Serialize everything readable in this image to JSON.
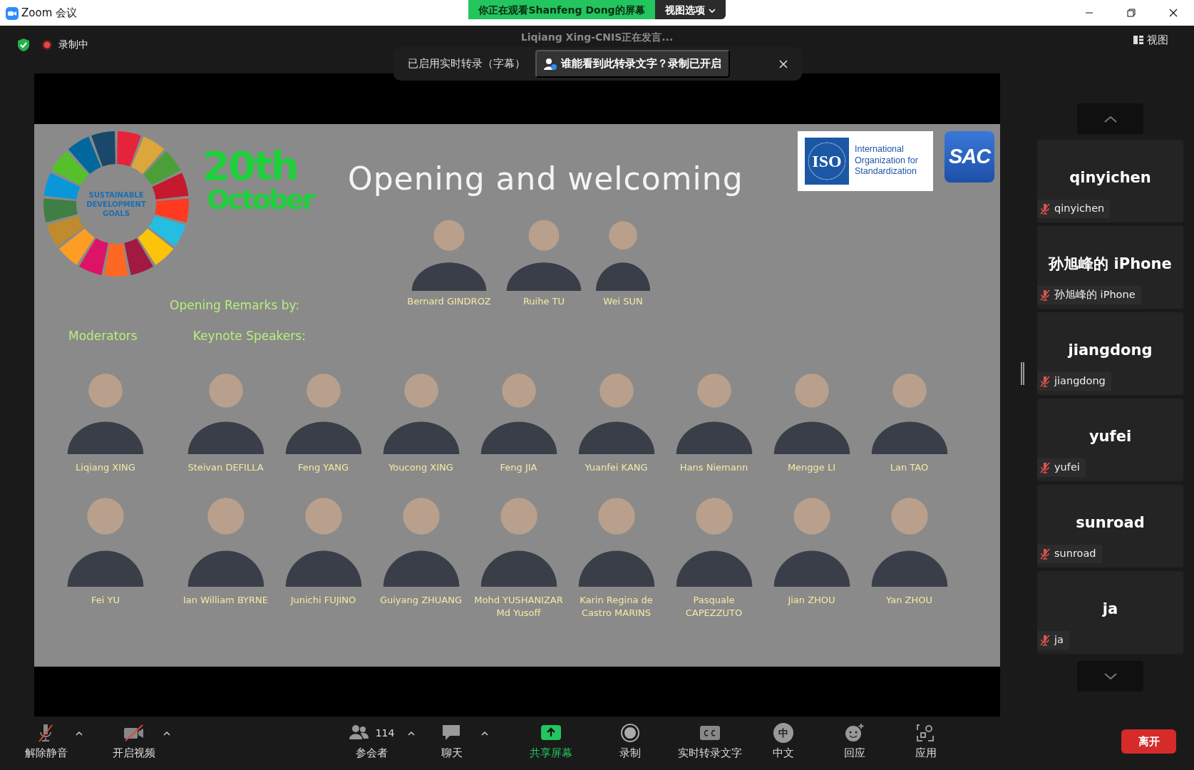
{
  "window": {
    "title": "Zoom 会议"
  },
  "share_banner": {
    "viewing": "你正在观看Shanfeng Dong的屏幕",
    "view_options": "视图选项"
  },
  "meeting_bar": {
    "recording": "录制中",
    "speaker": "Liqiang  Xing-CNIS正在发言...",
    "view": "视图"
  },
  "transcript_notice": {
    "status": "已启用实时转录（字幕）",
    "question": "谁能看到此转录文字？录制已开启"
  },
  "slide": {
    "sdg_logo_text": "SUSTAINABLE DEVELOPMENT GOALS",
    "date": [
      "20th",
      "October"
    ],
    "title": "Opening and welcoming",
    "iso_mark": "ISO",
    "iso_name": "International Organization for Standardization",
    "sac_mark": "SAC",
    "remarks_label": "Opening Remarks by:",
    "remarks_speakers": [
      {
        "name": "Bernard GINDROZ"
      },
      {
        "name": "Ruihe TU"
      },
      {
        "name": "Wei SUN"
      }
    ],
    "moderators_label": "Moderators",
    "keynote_label": "Keynote Speakers:",
    "moderators": [
      {
        "name": "Liqiang XING"
      },
      {
        "name": "Fei YU"
      }
    ],
    "keynote_speakers": [
      {
        "name": "Steivan DEFILLA"
      },
      {
        "name": "Feng YANG"
      },
      {
        "name": "Youcong XING"
      },
      {
        "name": "Feng JIA"
      },
      {
        "name": "Yuanfei KANG"
      },
      {
        "name": "Hans Niemann"
      },
      {
        "name": "Mengge LI"
      },
      {
        "name": "Lan TAO"
      },
      {
        "name": "Ian William BYRNE"
      },
      {
        "name": "Junichi FUJINO"
      },
      {
        "name": "Guiyang ZHUANG"
      },
      {
        "name": "Mohd YUSHANIZAR\nMd Yusoff"
      },
      {
        "name": "Karin Regina de\nCastro MARINS"
      },
      {
        "name": "Pasquale\nCAPEZZUTO"
      },
      {
        "name": "Jian ZHOU"
      },
      {
        "name": "Yan ZHOU"
      }
    ]
  },
  "participants": [
    {
      "display_name": "qinyichen",
      "label": "qinyichen",
      "muted": true
    },
    {
      "display_name": "孙旭峰的 iPhone",
      "label": "孙旭峰的 iPhone",
      "muted": true
    },
    {
      "display_name": "jiangdong",
      "label": "jiangdong",
      "muted": true
    },
    {
      "display_name": "yufei",
      "label": "yufei",
      "muted": true
    },
    {
      "display_name": "sunroad",
      "label": "sunroad",
      "muted": true
    },
    {
      "display_name": "ja",
      "label": "ja",
      "muted": true
    }
  ],
  "toolbar": {
    "items": [
      {
        "kind": "mic",
        "label": "解除静音",
        "off": true,
        "caret": true
      },
      {
        "kind": "video",
        "label": "开启视频",
        "off": true,
        "caret": true
      },
      {
        "kind": "participants",
        "label": "参会者",
        "count": "114",
        "caret": true
      },
      {
        "kind": "chat",
        "label": "聊天",
        "caret": true
      },
      {
        "kind": "share",
        "label": "共享屏幕",
        "caret": false
      },
      {
        "kind": "record",
        "label": "录制",
        "caret": false
      },
      {
        "kind": "captions",
        "label": "实时转录文字",
        "caret": false
      },
      {
        "kind": "language",
        "label": "中文",
        "glyph": "中",
        "caret": false
      },
      {
        "kind": "reactions",
        "label": "回应",
        "caret": false
      },
      {
        "kind": "apps",
        "label": "应用",
        "caret": false
      }
    ],
    "leave": "离开"
  }
}
